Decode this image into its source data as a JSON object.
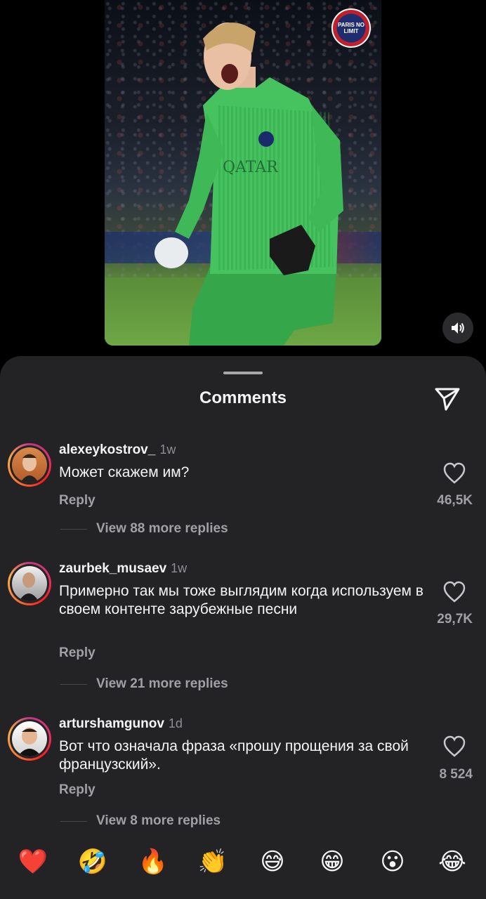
{
  "media": {
    "badge_text": "PARIS NO LIMIT"
  },
  "sheet": {
    "title": "Comments"
  },
  "comments": [
    {
      "username": "alexeykostrov_",
      "time": "1w",
      "text": "Может скажем им?",
      "reply_label": "Reply",
      "likes": "46,5K",
      "more_replies": "View 88 more replies"
    },
    {
      "username": "zaurbek_musaev",
      "time": "1w",
      "text": "Примерно так мы тоже выглядим когда используем в своем контенте зарубежные песни",
      "reply_label": "Reply",
      "likes": "29,7K",
      "more_replies": "View 21 more replies"
    },
    {
      "username": "arturshamgunov",
      "time": "1d",
      "text": "Вот что означала фраза «прошу прощения за свой французский».",
      "reply_label": "Reply",
      "likes": "8 524",
      "more_replies": "View 8 more replies"
    }
  ],
  "reactions": [
    "❤️",
    "🤣",
    "🔥",
    "👏",
    "😅",
    "😁",
    "😮",
    "😂"
  ],
  "colors": {
    "sheet_bg": "#232326",
    "muted_text": "#a0a0a5",
    "jersey_green": "#3fbf5a"
  },
  "icons": {
    "mute": "speaker-icon",
    "share": "paper-plane-icon",
    "like": "heart-outline-icon"
  }
}
